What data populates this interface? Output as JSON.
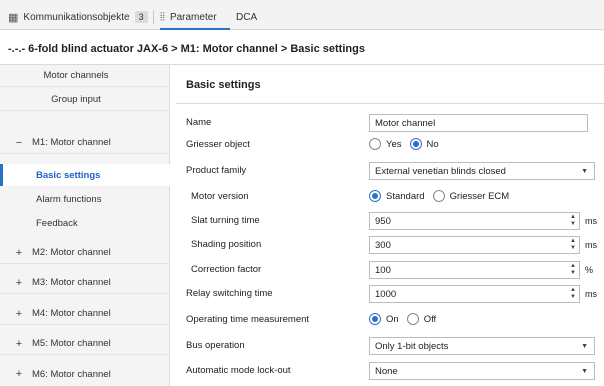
{
  "tabs": [
    {
      "label": "Kommunikationsobjekte",
      "count": "3",
      "icon": "table-icon"
    },
    {
      "label": "Parameter",
      "icon": "parameter-icon"
    },
    {
      "label": "DCA"
    }
  ],
  "breadcrumb": "-.-.- 6-fold blind actuator JAX-6 > M1: Motor channel > Basic settings",
  "sidebar": {
    "items": [
      {
        "label": "Motor channels"
      },
      {
        "label": "Group input"
      },
      {
        "label": "M1: Motor channel",
        "symbol": "−"
      },
      {
        "label": "Basic settings",
        "sub": true,
        "active": true
      },
      {
        "label": "Alarm functions",
        "sub": true
      },
      {
        "label": "Feedback",
        "sub": true
      },
      {
        "label": "M2: Motor channel",
        "symbol": "+"
      },
      {
        "label": "M3: Motor channel",
        "symbol": "+"
      },
      {
        "label": "M4: Motor channel",
        "symbol": "+"
      },
      {
        "label": "M5: Motor channel",
        "symbol": "+"
      },
      {
        "label": "M6: Motor channel",
        "symbol": "+"
      }
    ]
  },
  "main": {
    "title": "Basic settings",
    "fields": {
      "name": {
        "label": "Name",
        "value": "Motor channel"
      },
      "griesser": {
        "label": "Griesser object",
        "options": [
          "Yes",
          "No"
        ],
        "selected": "No"
      },
      "product_family": {
        "label": "Product family",
        "value": "External venetian blinds closed"
      },
      "motor_version": {
        "label": "Motor version",
        "options": [
          "Standard",
          "Griesser ECM"
        ],
        "selected": "Standard"
      },
      "slat_turning": {
        "label": "Slat turning time",
        "value": "950",
        "unit": "ms"
      },
      "shading_position": {
        "label": "Shading position",
        "value": "300",
        "unit": "ms"
      },
      "correction_factor": {
        "label": "Correction factor",
        "value": "100",
        "unit": "%"
      },
      "relay_switching": {
        "label": "Relay switching time",
        "value": "1000",
        "unit": "ms"
      },
      "operating_time": {
        "label": "Operating time measurement",
        "options": [
          "On",
          "Off"
        ],
        "selected": "On"
      },
      "bus_operation": {
        "label": "Bus operation",
        "value": "Only 1-bit objects"
      },
      "auto_lockout": {
        "label": "Automatic mode lock-out",
        "value": "None"
      }
    }
  },
  "colors": {
    "accent": "#2a72c9",
    "sidebar_bg": "#f4f4f4"
  }
}
